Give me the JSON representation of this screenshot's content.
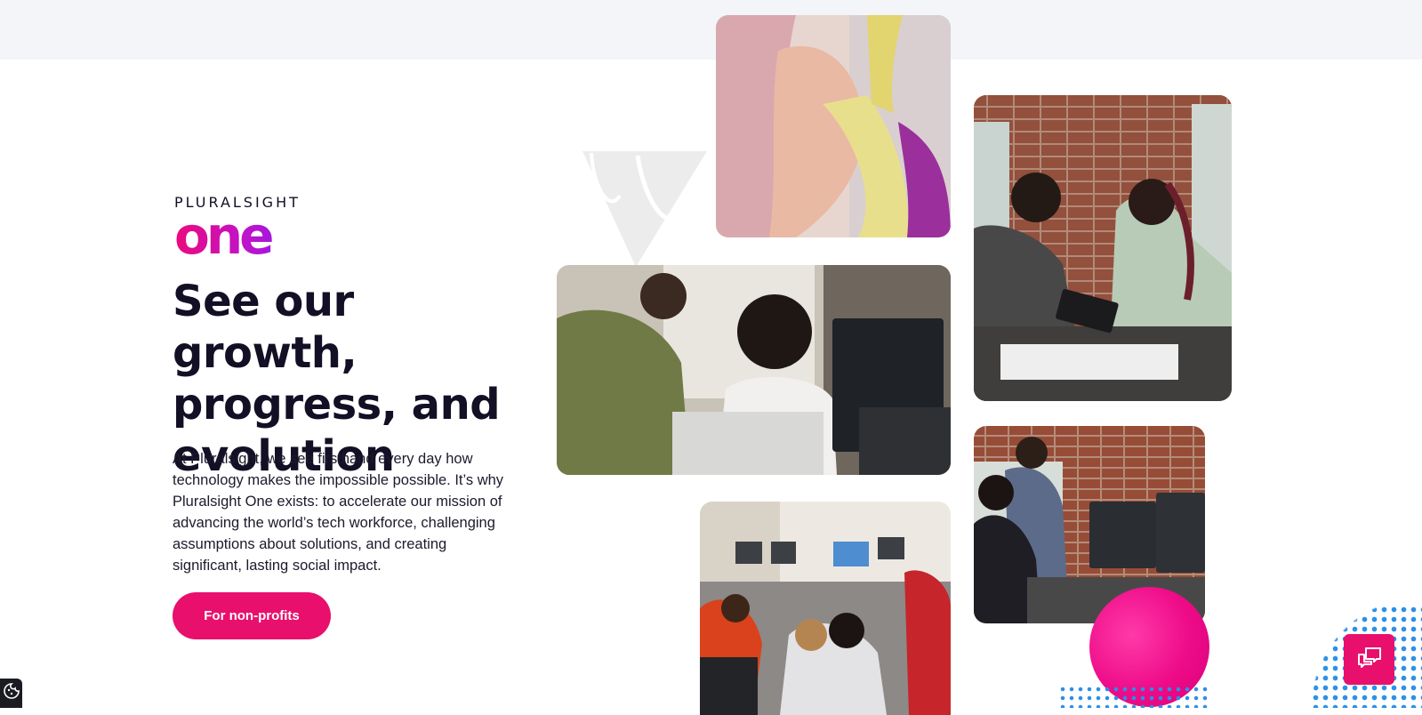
{
  "brand": {
    "top": "PLURALSIGHT",
    "product": "one"
  },
  "headline": "See our growth, progress, and evolution",
  "body": "At Pluralsight, we see firsthand every day how technology makes the impossible possible. It’s why Pluralsight One exists: to accelerate our mission of advancing the world’s tech workforce, challenging assumptions about solutions, and creating significant, lasting social impact.",
  "cta_label": "For non-profits",
  "colors": {
    "accent": "#e8106c",
    "text": "#130f25",
    "top_band": "#f3f5f8",
    "dots": "#2c91ea"
  },
  "icons": {
    "chat": "chat-icon",
    "cookie": "cookie-icon"
  }
}
